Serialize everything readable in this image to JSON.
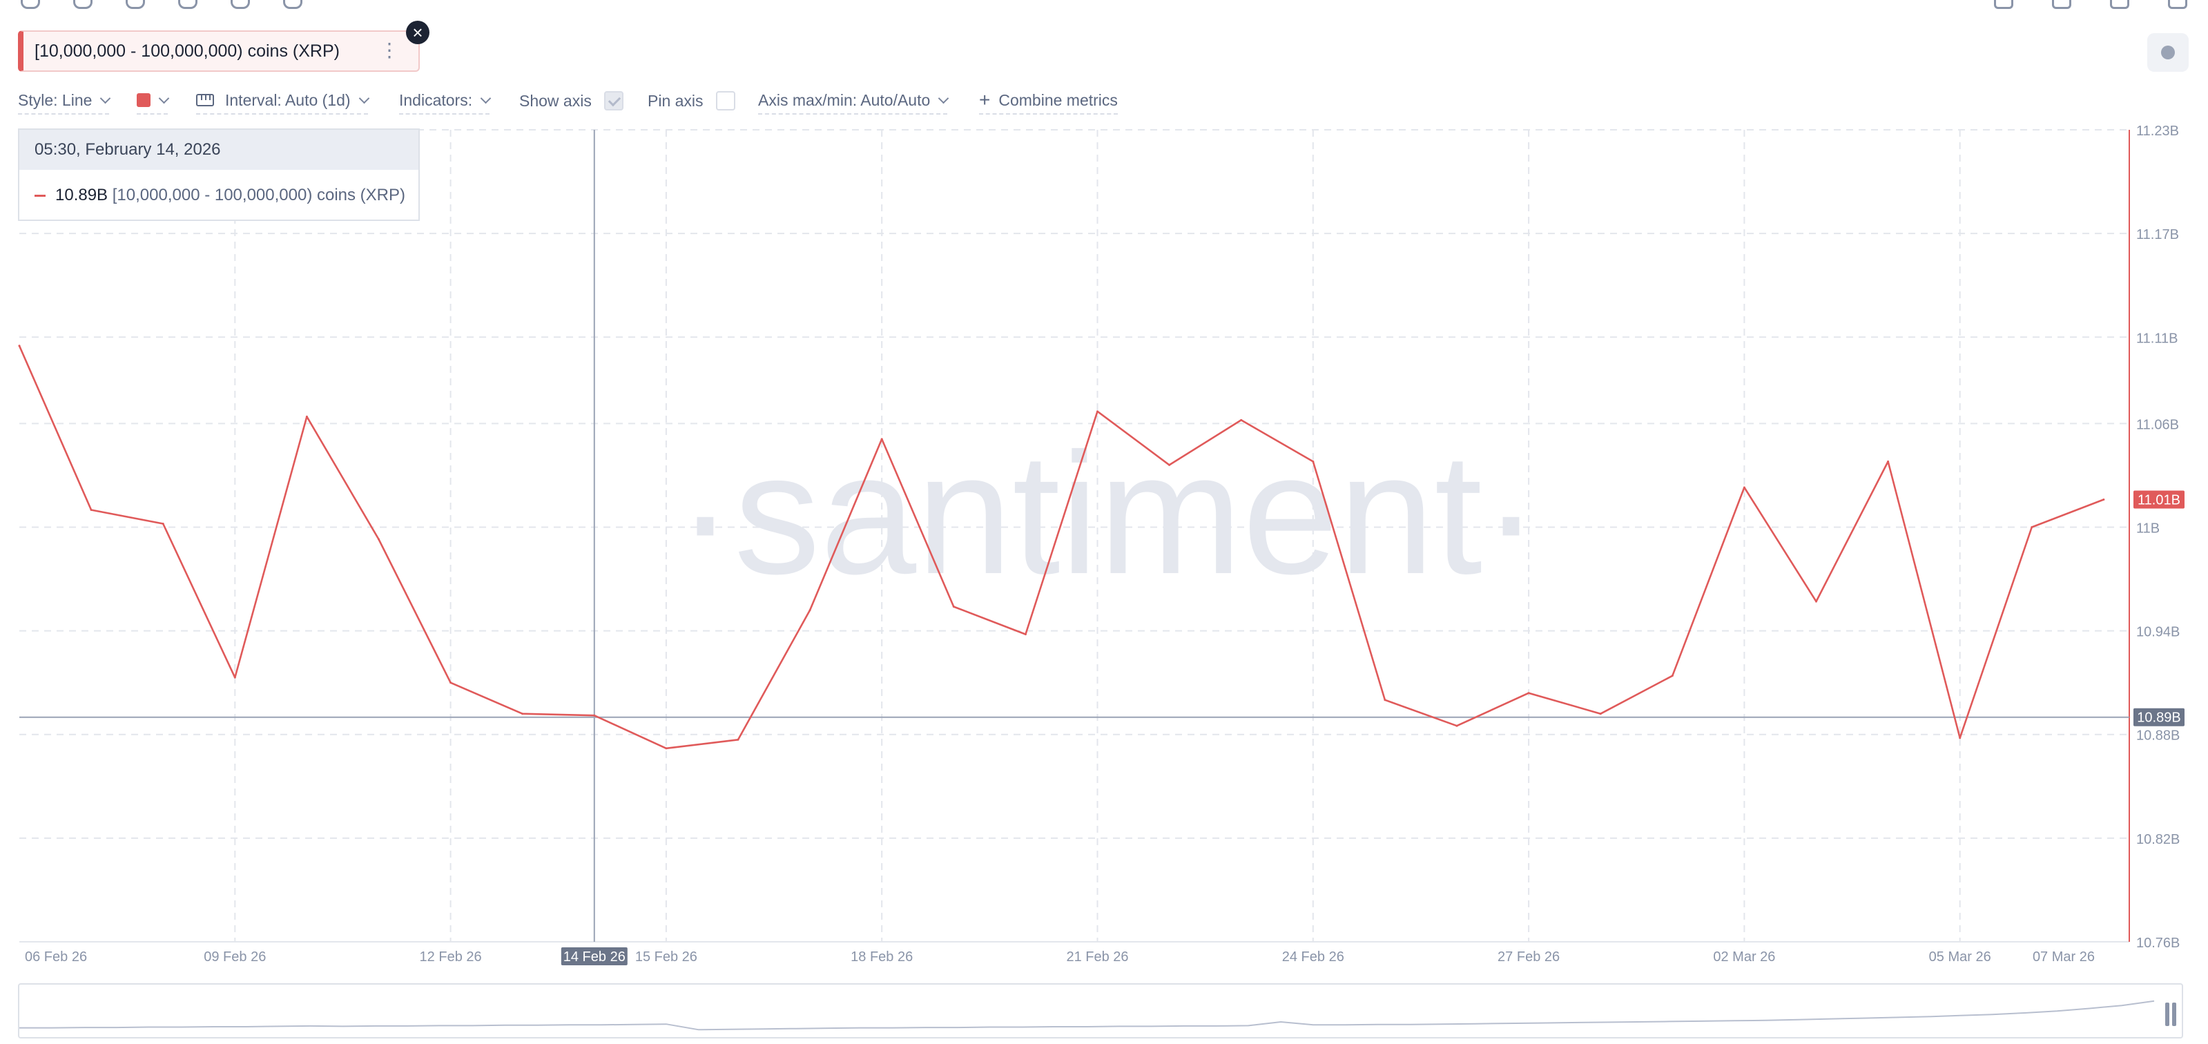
{
  "metric": {
    "label": "[10,000,000 - 100,000,000) coins (XRP)",
    "menu_icon": "kebab-icon",
    "close_icon": "close-icon",
    "color": "#e05a5a"
  },
  "toolbar": {
    "style": "Style: Line",
    "interval": "Interval: Auto (1d)",
    "indicators": "Indicators:",
    "show_axis": "Show axis",
    "pin_axis": "Pin axis",
    "axis_maxmin": "Axis max/min: Auto/Auto",
    "combine": "Combine metrics"
  },
  "tooltip": {
    "date": "05:30, February 14, 2026",
    "value": "10.89B",
    "name": "[10,000,000 - 100,000,000) coins (XRP)"
  },
  "watermark": "·santiment·",
  "chart_data": {
    "type": "line",
    "title": "",
    "x": [
      "06 Feb 26",
      "07 Feb 26",
      "08 Feb 26",
      "09 Feb 26",
      "10 Feb 26",
      "11 Feb 26",
      "12 Feb 26",
      "13 Feb 26",
      "14 Feb 26",
      "15 Feb 26",
      "16 Feb 26",
      "17 Feb 26",
      "18 Feb 26",
      "19 Feb 26",
      "20 Feb 26",
      "21 Feb 26",
      "22 Feb 26",
      "23 Feb 26",
      "24 Feb 26",
      "25 Feb 26",
      "26 Feb 26",
      "27 Feb 26",
      "28 Feb 26",
      "01 Mar 26",
      "02 Mar 26",
      "03 Mar 26",
      "04 Mar 26",
      "05 Mar 26",
      "06 Mar 26",
      "07 Mar 26"
    ],
    "series": [
      {
        "name": "[10,000,000 - 100,000,000) coins (XRP)",
        "color": "#e05a5a",
        "values": [
          11.105,
          11.01,
          11.002,
          10.913,
          11.064,
          10.993,
          10.91,
          10.892,
          10.891,
          10.872,
          10.877,
          10.952,
          11.051,
          10.954,
          10.938,
          11.067,
          11.036,
          11.062,
          11.038,
          10.9,
          10.885,
          10.904,
          10.892,
          10.914,
          11.023,
          10.957,
          11.038,
          10.878,
          11.0,
          11.016
        ]
      }
    ],
    "x_tick_labels": [
      "06 Feb 26",
      "09 Feb 26",
      "12 Feb 26",
      "15 Feb 26",
      "18 Feb 26",
      "21 Feb 26",
      "24 Feb 26",
      "27 Feb 26",
      "02 Mar 26",
      "05 Mar 26",
      "07 Mar 26"
    ],
    "y_ticks": [
      10.76,
      10.82,
      10.88,
      10.94,
      11.0,
      11.06,
      11.11,
      11.17,
      11.23
    ],
    "y_tick_labels": [
      "10.76B",
      "10.82B",
      "10.88B",
      "10.94B",
      "11B",
      "11.06B",
      "11.11B",
      "11.17B",
      "11.23B"
    ],
    "ylim": [
      10.76,
      11.23
    ],
    "grid": true,
    "crosshair": {
      "x": "14 Feb 26",
      "y": 10.89,
      "x_label": "14 Feb 26",
      "y_label": "10.89B"
    },
    "last_value_label": "11.01B",
    "navigator": [
      0.1,
      0.1,
      0.11,
      0.11,
      0.12,
      0.12,
      0.13,
      0.13,
      0.14,
      0.15,
      0.14,
      0.15,
      0.15,
      0.16,
      0.16,
      0.17,
      0.17,
      0.18,
      0.18,
      0.19,
      0.2,
      0.05,
      0.06,
      0.07,
      0.08,
      0.09,
      0.1,
      0.1,
      0.11,
      0.11,
      0.12,
      0.12,
      0.13,
      0.13,
      0.14,
      0.14,
      0.15,
      0.15,
      0.16,
      0.26,
      0.18,
      0.18,
      0.19,
      0.19,
      0.2,
      0.21,
      0.22,
      0.23,
      0.24,
      0.25,
      0.26,
      0.27,
      0.28,
      0.29,
      0.3,
      0.32,
      0.34,
      0.36,
      0.38,
      0.4,
      0.43,
      0.46,
      0.5,
      0.55,
      0.62,
      0.7,
      0.82
    ]
  }
}
